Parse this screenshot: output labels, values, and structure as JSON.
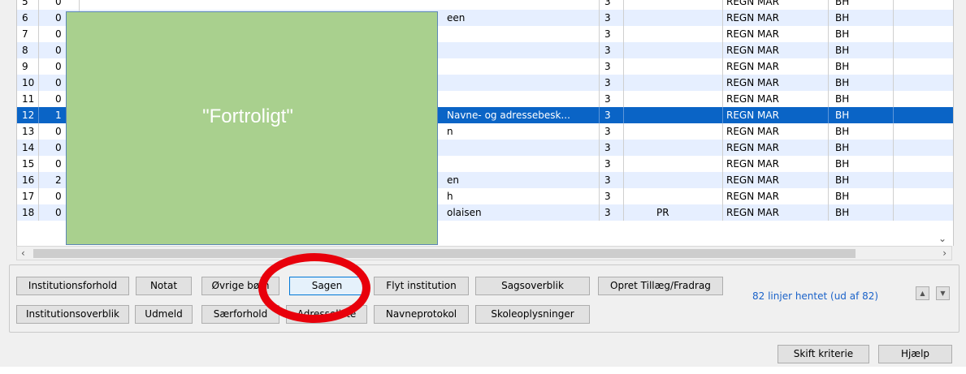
{
  "grid": {
    "rows": [
      {
        "num": "5",
        "code": "0",
        "name": "",
        "k": "3",
        "fl": "",
        "reg": "REGN MAR",
        "bh": "BH"
      },
      {
        "num": "6",
        "code": "0",
        "name": "een",
        "k": "3",
        "fl": "",
        "reg": "REGN MAR",
        "bh": "BH"
      },
      {
        "num": "7",
        "code": "0",
        "name": "",
        "k": "3",
        "fl": "",
        "reg": "REGN MAR",
        "bh": "BH"
      },
      {
        "num": "8",
        "code": "0",
        "name": "",
        "k": "3",
        "fl": "",
        "reg": "REGN MAR",
        "bh": "BH"
      },
      {
        "num": "9",
        "code": "0",
        "name": "",
        "k": "3",
        "fl": "",
        "reg": "REGN MAR",
        "bh": "BH"
      },
      {
        "num": "10",
        "code": "0",
        "name": "",
        "k": "3",
        "fl": "",
        "reg": "REGN MAR",
        "bh": "BH"
      },
      {
        "num": "11",
        "code": "0",
        "name": "",
        "k": "3",
        "fl": "",
        "reg": "REGN MAR",
        "bh": "BH"
      },
      {
        "num": "12",
        "code": "1",
        "name": "Navne- og adressebesk...",
        "k": "3",
        "fl": "",
        "reg": "REGN MAR",
        "bh": "BH"
      },
      {
        "num": "13",
        "code": "0",
        "name": "n",
        "k": "3",
        "fl": "",
        "reg": "REGN MAR",
        "bh": "BH"
      },
      {
        "num": "14",
        "code": "0",
        "name": "",
        "k": "3",
        "fl": "",
        "reg": "REGN MAR",
        "bh": "BH"
      },
      {
        "num": "15",
        "code": "0",
        "name": "",
        "k": "3",
        "fl": "",
        "reg": "REGN MAR",
        "bh": "BH"
      },
      {
        "num": "16",
        "code": "2",
        "name": "en",
        "k": "3",
        "fl": "",
        "reg": "REGN MAR",
        "bh": "BH"
      },
      {
        "num": "17",
        "code": "0",
        "name": "h",
        "k": "3",
        "fl": "",
        "reg": "REGN MAR",
        "bh": "BH"
      },
      {
        "num": "18",
        "code": "0",
        "name": "olaisen",
        "k": "3",
        "fl": "PR",
        "reg": "REGN MAR",
        "bh": "BH"
      }
    ],
    "selected_row": "12",
    "scroll_down_icon": "chevron-down-icon",
    "scroll_left_icon": "chevron-left-icon",
    "scroll_right_icon": "chevron-right-icon"
  },
  "overlay": {
    "label": "\"Fortroligt\"",
    "color": "#a9d08e"
  },
  "buttons": {
    "institutionsforhold": "Institutionsforhold",
    "notat": "Notat",
    "oevrige_boern": "Øvrige børn",
    "sagen": "Sagen",
    "flyt_institution": "Flyt institution",
    "sagsoverblik": "Sagsoverblik",
    "opret_tillaeg": "Opret Tillæg/Fradrag",
    "institutionsoverblik": "Institutionsoverblik",
    "udmeld": "Udmeld",
    "saerforhold": "Særforhold",
    "adresseliste": "Adresseliste",
    "navneprotokol": "Navneprotokol",
    "skoleoplysninger": "Skoleoplysninger",
    "skift_kriterie": "Skift kriterie",
    "hjaelp": "Hjælp"
  },
  "status": {
    "rows_fetched": "82 linjer hentet (ud af 82)"
  },
  "colors": {
    "selection": "#0a64c6",
    "alt_row": "#e6efff",
    "annotation_circle": "#e8000b",
    "status_text": "#1a62c9"
  }
}
